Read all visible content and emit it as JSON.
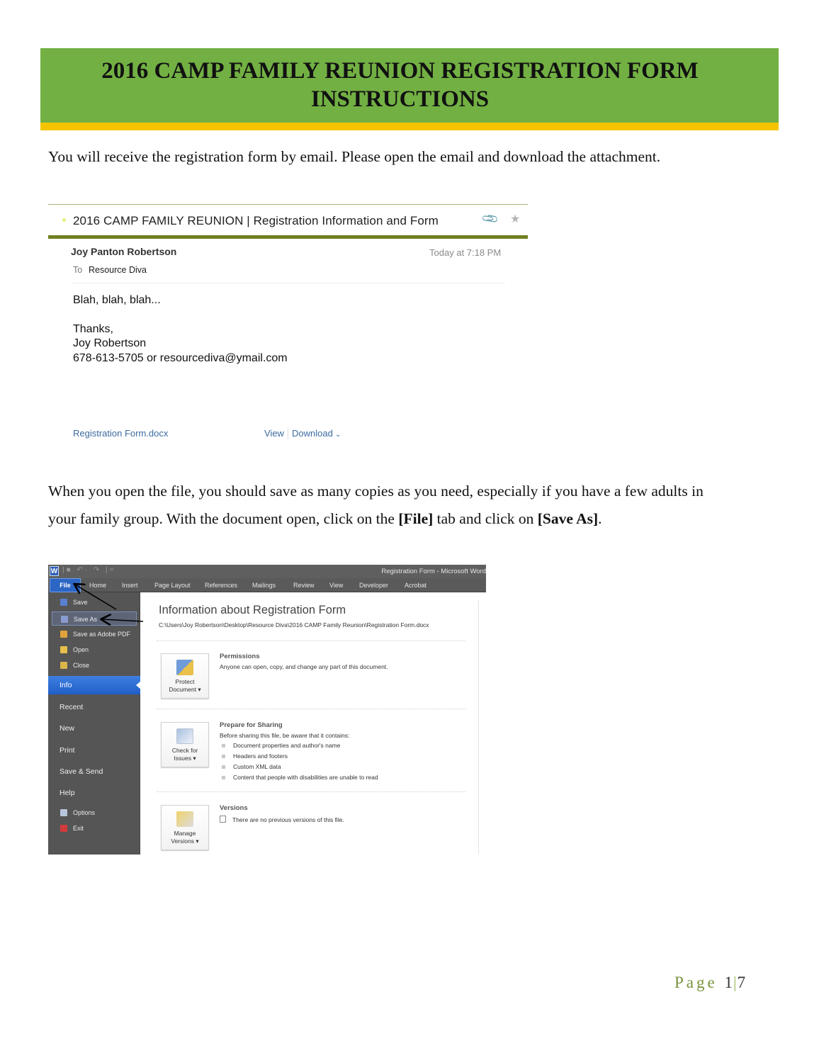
{
  "header": {
    "title_line1": "2016 CAMP FAMILY REUNION REGISTRATION FORM",
    "title_line2": "INSTRUCTIONS",
    "banner_color": "#72b043",
    "stripe_color": "#f5c400"
  },
  "paragraph1": "You will receive the registration form by email. Please open the email and download the attachment.",
  "email": {
    "subject": "2016 CAMP FAMILY REUNION | Registration Information and Form",
    "attachment_icon": "paperclip-icon",
    "star_icon": "star-icon",
    "from": "Joy Panton Robertson",
    "time": "Today at 7:18 PM",
    "to_label": "To",
    "to": "Resource Diva",
    "body": {
      "line1": "Blah, blah, blah...",
      "line2": "Thanks,",
      "line3": "Joy Robertson",
      "line4": "678-613-5705 or resourcediva@ymail.com"
    },
    "attachment_name": "Registration Form.docx",
    "view_label": "View",
    "download_label": "Download"
  },
  "paragraph2": {
    "line1": "When you open the file, you should save as many copies as you need, especially if you have a few adults in",
    "line2_a": "your family group. With the document open, click on the ",
    "line2_b": "[File]",
    "line2_c": " tab and click on ",
    "line2_d": "[Save As]",
    "line2_e": "."
  },
  "word": {
    "window_title": "Registration Form - Microsoft Word",
    "tabs": [
      "File",
      "Home",
      "Insert",
      "Page Layout",
      "References",
      "Mailings",
      "Review",
      "View",
      "Developer",
      "Acrobat"
    ],
    "file_menu_sub": [
      "Save",
      "Save As",
      "Save as Adobe PDF",
      "Open",
      "Close"
    ],
    "file_menu_main": [
      "Info",
      "Recent",
      "New",
      "Print",
      "Save & Send",
      "Help"
    ],
    "file_menu_bottom": [
      "Options",
      "Exit"
    ],
    "info_title": "Information about Registration Form",
    "path": "C:\\Users\\Joy Robertson\\Desktop\\Resource Diva\\2016 CAMP Family Reunion\\Registration Form.docx",
    "permissions": {
      "button_line1": "Protect",
      "button_line2": "Document ▾",
      "title": "Permissions",
      "text": "Anyone can open, copy, and change any part of this document."
    },
    "sharing": {
      "button_line1": "Check for",
      "button_line2": "Issues ▾",
      "title": "Prepare for Sharing",
      "text": "Before sharing this file, be aware that it contains:",
      "bullets": [
        "Document properties and author's name",
        "Headers and footers",
        "Custom XML data",
        "Content that people with disabilities are unable to read"
      ]
    },
    "versions": {
      "button_line1": "Manage",
      "button_line2": "Versions ▾",
      "title": "Versions",
      "text": "There are no previous versions of this file."
    }
  },
  "footer": {
    "page_label": "Page",
    "current": "1",
    "separator": "|",
    "total": "7"
  }
}
